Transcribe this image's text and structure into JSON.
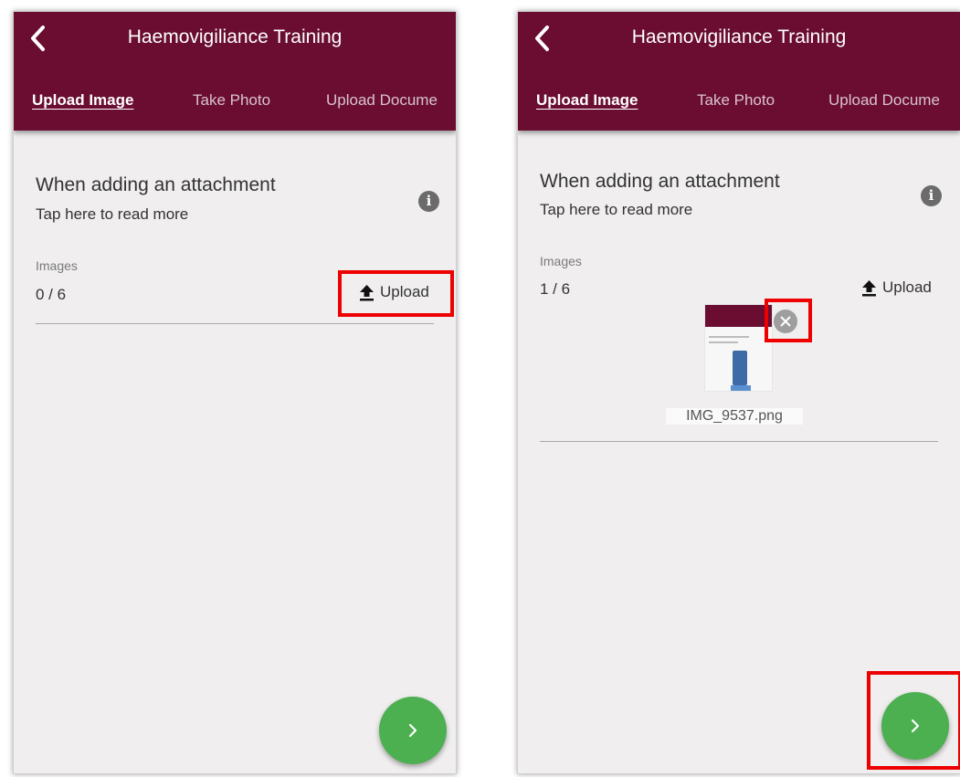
{
  "screens": [
    {
      "title": "Haemovigiliance Training",
      "tabs": {
        "upload_image": "Upload Image",
        "take_photo": "Take Photo",
        "upload_document": "Upload Docume"
      },
      "info": {
        "title": "When adding an attachment",
        "subtitle": "Tap here to read more",
        "icon": "info-icon"
      },
      "images": {
        "label": "Images",
        "count": "0 / 6",
        "upload_label": "Upload"
      }
    },
    {
      "title": "Haemovigiliance Training",
      "tabs": {
        "upload_image": "Upload Image",
        "take_photo": "Take Photo",
        "upload_document": "Upload Docume"
      },
      "info": {
        "title": "When adding an attachment",
        "subtitle": "Tap here to read more",
        "icon": "info-icon"
      },
      "images": {
        "label": "Images",
        "count": "1 / 6",
        "upload_label": "Upload"
      },
      "attachment": {
        "filename": "IMG_9537.png"
      }
    }
  ],
  "colors": {
    "appbar": "#6a0d31",
    "fab": "#4caf50",
    "highlight": "#ee0000",
    "background": "#f0eeef"
  }
}
